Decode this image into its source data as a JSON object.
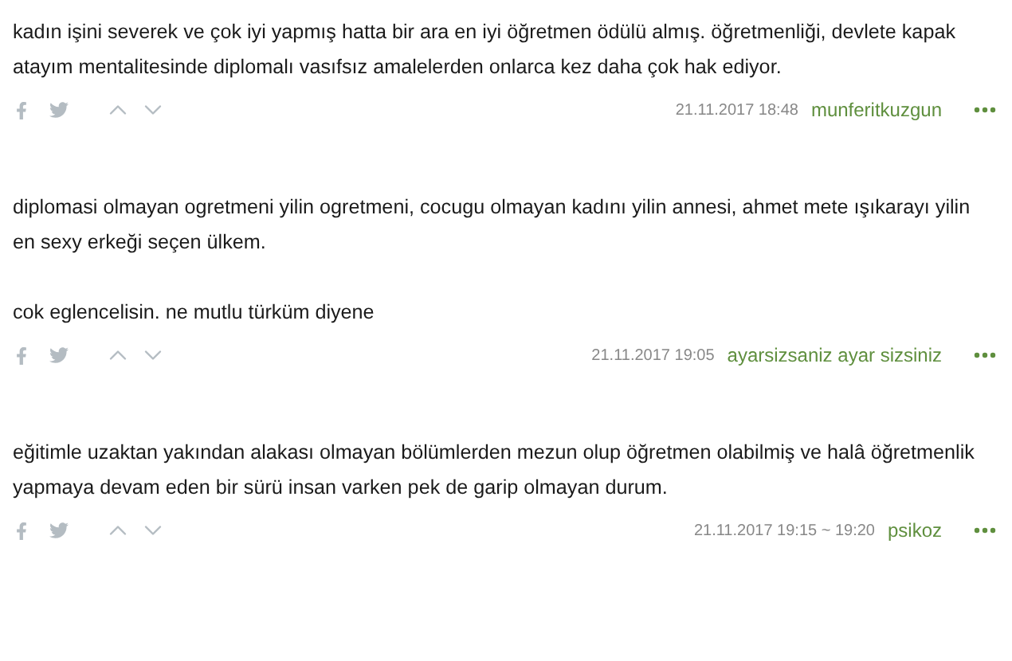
{
  "entries": [
    {
      "paragraphs": [
        "kadın işini severek ve çok iyi yapmış hatta bir ara en iyi öğretmen ödülü almış. öğretmenliği, devlete kapak atayım mentalitesinde diplomalı vasıfsız amalelerden onlarca kez daha çok hak ediyor."
      ],
      "date": "21.11.2017 18:48",
      "author": "munferitkuzgun"
    },
    {
      "paragraphs": [
        "diplomasi olmayan ogretmeni yilin ogretmeni, cocugu olmayan kadını yilin annesi, ahmet mete ışıkarayı yilin en sexy erkeği seçen ülkem.",
        "cok eglencelisin. ne mutlu türküm diyene"
      ],
      "date": "21.11.2017 19:05",
      "author": "ayarsizsaniz ayar sizsiniz"
    },
    {
      "paragraphs": [
        "eğitimle uzaktan yakından alakası olmayan bölümlerden mezun olup öğretmen olabilmiş ve halâ öğretmenlik yapmaya devam eden bir sürü insan varken pek de garip olmayan durum."
      ],
      "date": "21.11.2017 19:15 ~ 19:20",
      "author": "psikoz"
    }
  ]
}
